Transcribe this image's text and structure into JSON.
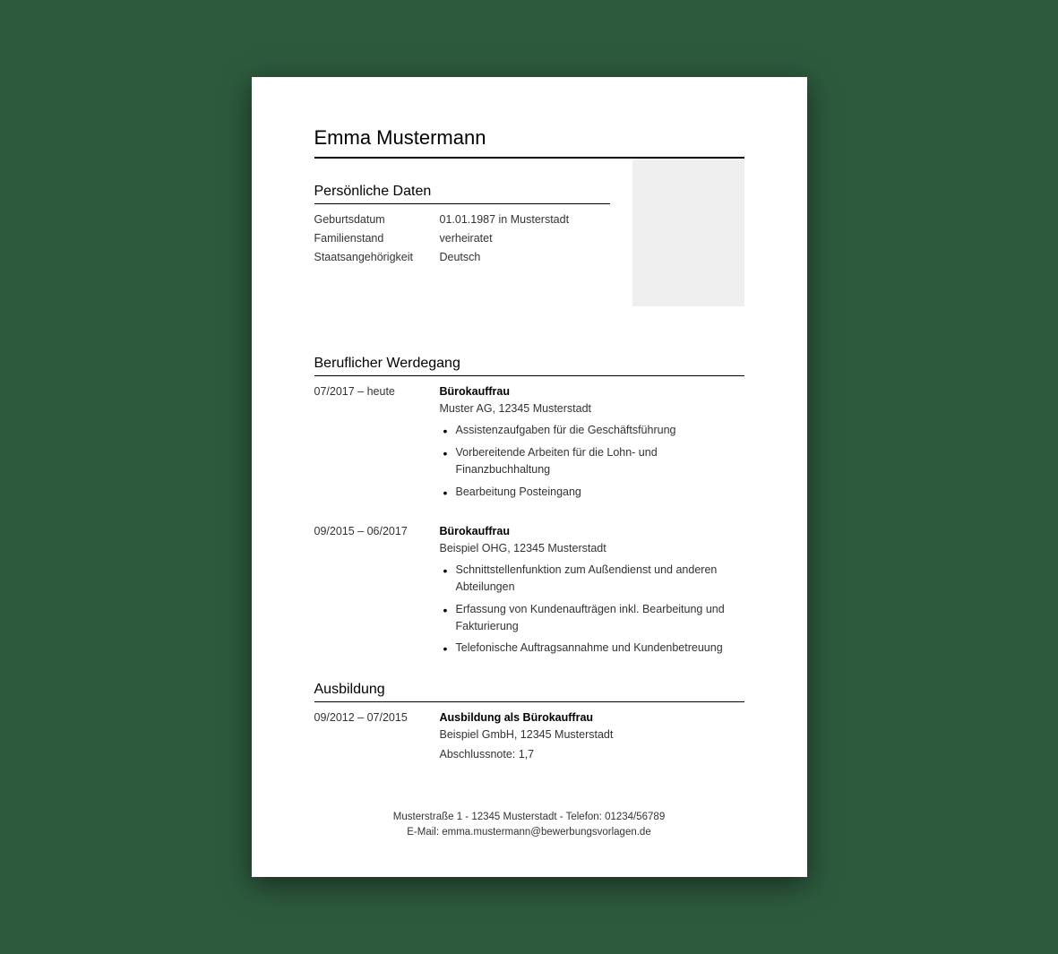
{
  "name": "Emma Mustermann",
  "sections": {
    "personal": {
      "heading": "Persönliche Daten",
      "birth_label": "Geburtsdatum",
      "birth_value": "01.01.1987 in Musterstadt",
      "marital_label": "Familienstand",
      "marital_value": "verheiratet",
      "nationality_label": "Staatsangehörigkeit",
      "nationality_value": "Deutsch"
    },
    "career": {
      "heading": "Beruflicher Werdegang",
      "entries": [
        {
          "date": "07/2017 – heute",
          "title": "Bürokauffrau",
          "subtitle": "Muster AG, 12345 Musterstadt",
          "bullets": [
            "Assistenzaufgaben für die Geschäftsführung",
            "Vorbereitende Arbeiten für die Lohn- und Finanzbuchhaltung",
            "Bearbeitung Posteingang"
          ]
        },
        {
          "date": "09/2015 – 06/2017",
          "title": "Bürokauffrau",
          "subtitle": "Beispiel OHG, 12345 Musterstadt",
          "bullets": [
            "Schnittstellenfunktion zum Außendienst und anderen Abteilungen",
            "Erfassung von Kundenaufträgen inkl. Bearbeitung und Fakturierung",
            "Telefonische Auftragsannahme und Kundenbetreuung"
          ]
        }
      ]
    },
    "education": {
      "heading": "Ausbildung",
      "entries": [
        {
          "date": "09/2012 – 07/2015",
          "title": "Ausbildung als Bürokauffrau",
          "subtitle": "Beispiel GmbH, 12345 Musterstadt",
          "note": "Abschlussnote: 1,7"
        }
      ]
    }
  },
  "footer": {
    "line1": "Musterstraße 1 - 12345 Musterstadt - Telefon: 01234/56789",
    "line2": "E-Mail: emma.mustermann@bewerbungsvorlagen.de"
  }
}
